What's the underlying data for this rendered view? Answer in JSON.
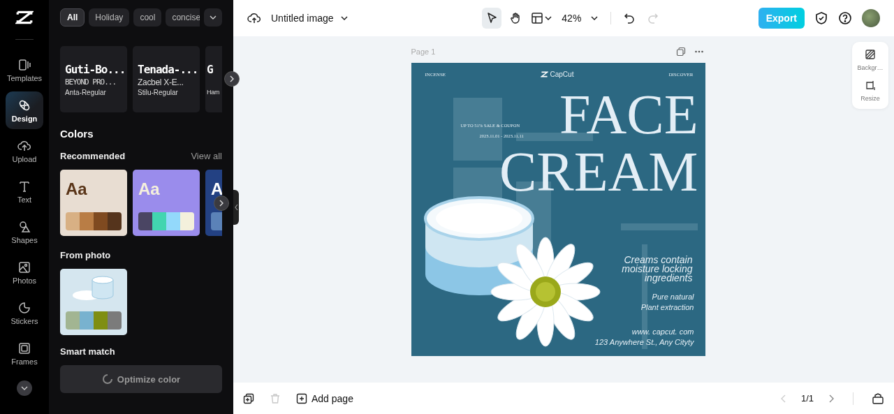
{
  "rail": {
    "items": [
      {
        "label": "Templates",
        "kind": "templates",
        "selected": false
      },
      {
        "label": "Design",
        "kind": "design",
        "selected": true
      },
      {
        "label": "Upload",
        "kind": "upload",
        "selected": false
      },
      {
        "label": "Text",
        "kind": "text",
        "selected": false
      },
      {
        "label": "Shapes",
        "kind": "shapes",
        "selected": false
      },
      {
        "label": "Photos",
        "kind": "photos",
        "selected": false
      },
      {
        "label": "Stickers",
        "kind": "stickers",
        "selected": false
      },
      {
        "label": "Frames",
        "kind": "frames",
        "selected": false
      }
    ]
  },
  "panel": {
    "filters": [
      {
        "label": "All",
        "selected": true
      },
      {
        "label": "Holiday",
        "selected": false
      },
      {
        "label": "cool",
        "selected": false
      },
      {
        "label": "concise",
        "selected": false
      }
    ],
    "fonts": [
      {
        "title": "Guti-Bo...",
        "subtitle": "BEYOND PRO...",
        "caption": "Anta-Regular"
      },
      {
        "title": "Tenada-...",
        "subtitle": "Zacbel X-E...",
        "caption": "Stilu-Regular"
      },
      {
        "title": "G",
        "caption": "Ham"
      }
    ],
    "colors_heading": "Colors",
    "recommended": "Recommended",
    "view_all": "View all",
    "palettes": [
      {
        "sample": {
          "text": "Aa",
          "color": "#5a3519"
        },
        "color": "#e8ddd2",
        "swatches": [
          {
            "color": "#d8b084"
          },
          {
            "color": "#b97d45"
          },
          {
            "color": "#7f4a20"
          },
          {
            "color": "#55341c"
          }
        ]
      },
      {
        "sample": {
          "text": "Aa",
          "color": "#f5f0dc"
        },
        "color": "#9a8cec",
        "swatches": [
          {
            "color": "#4a4563"
          },
          {
            "color": "#42d5b0"
          },
          {
            "color": "#93d9fb"
          },
          {
            "color": "#f4f0dc"
          }
        ]
      },
      {
        "sample": {
          "text": "A",
          "color": "#ffffff"
        },
        "color": "#234183",
        "swatches": [
          {
            "color": "#5b82b8"
          }
        ]
      }
    ],
    "from_photo": "From photo",
    "photo_swatches": [
      {
        "color": "#a2b592"
      },
      {
        "color": "#78b2cf"
      },
      {
        "color": "#7f8e12"
      },
      {
        "color": "#7b7b7b"
      }
    ],
    "smart_match": "Smart match",
    "optimize": "Optimize color"
  },
  "topbar": {
    "title": "Untitled image",
    "zoom": "42%",
    "redo_disabled": true,
    "export": "Export"
  },
  "canvas": {
    "page_label": "Page 1",
    "poster": {
      "left_tag": "INCENSE",
      "logo": "CapCut",
      "right_tag": "DISCOVER",
      "sale": "UP TO 51% SALE & COUPON",
      "dates": "2023.11.01 - 2023.11.11",
      "title_1": "FACE",
      "title_2": "CREAM",
      "blurb": "Creams contain\nmoisture locking\ningredients",
      "feature_1": "Pure natural",
      "feature_2": "Plant extraction",
      "website": "www. capcut. com",
      "address": "123 Anywhere St., Any Cityty"
    },
    "side_tools": [
      {
        "label": "Backgr…",
        "kind": "background"
      },
      {
        "label": "Resize",
        "kind": "resize"
      }
    ]
  },
  "bottom": {
    "delete_disabled": true,
    "add_page": "Add page",
    "prev_disabled": true,
    "pager": "1/1",
    "next_disabled": false
  }
}
